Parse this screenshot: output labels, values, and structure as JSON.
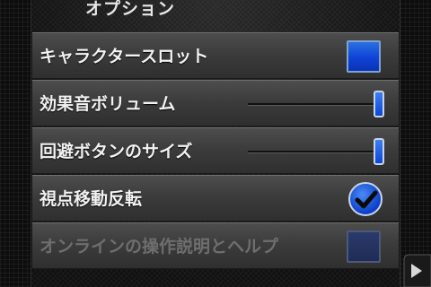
{
  "screen_title": "オプション",
  "options": [
    {
      "label": "キャラクタースロット",
      "control": "color-box"
    },
    {
      "label": "効果音ボリューム",
      "control": "slider",
      "value": 0.97
    },
    {
      "label": "回避ボタンのサイズ",
      "control": "slider",
      "value": 0.97
    },
    {
      "label": "視点移動反転",
      "control": "checkbox",
      "checked": true
    },
    {
      "label": "オンラインの操作説明とヘルプ",
      "control": "color-box",
      "disabled": true
    }
  ],
  "icons": {
    "checkmark": "checkmark-icon",
    "next_page": "page-turn-arrow-icon"
  },
  "colors": {
    "accent_blue": "#0f43d6",
    "row_gradient_top": "#4d4d4d",
    "label_text": "#f2f2f2"
  }
}
